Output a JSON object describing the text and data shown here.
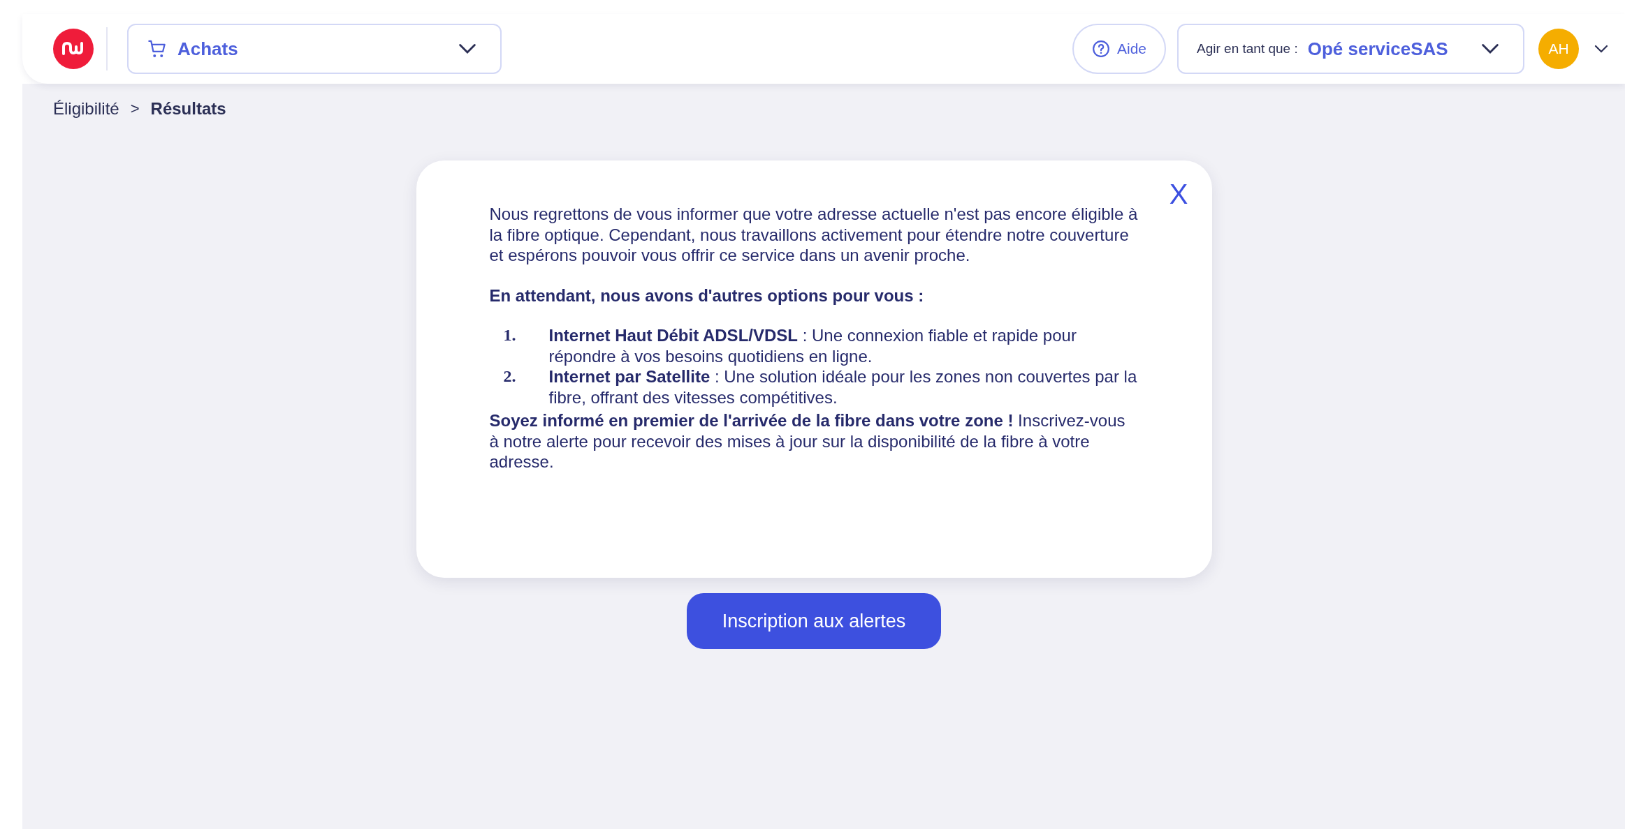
{
  "header": {
    "module_select": {
      "value": "Achats"
    },
    "help_button": {
      "label": "Aide"
    },
    "role_select": {
      "label": "Agir en tant que :",
      "value": "Opé serviceSAS"
    },
    "avatar": {
      "initials": "AH"
    }
  },
  "breadcrumb": {
    "separator": ">",
    "items": [
      {
        "label": "Éligibilité",
        "selected": false
      },
      {
        "label": "Résultats",
        "selected": true
      }
    ]
  },
  "modal": {
    "close": "X",
    "blocks": [
      {
        "kind": "paragraph",
        "text": "Nous regrettons de vous informer que votre adresse actuelle n'est pas encore éligible à la fibre optique. Cependant, nous travaillons activement pour étendre notre couverture et espérons pouvoir vous offrir ce service dans un avenir proche."
      },
      {
        "kind": "heading",
        "text": "En attendant, nous avons d'autres options pour vous :"
      },
      {
        "kind": "list",
        "items": [
          {
            "number": "1.",
            "text": "**Internet Haut Débit ADSL/VDSL** : Une connexion fiable et rapide pour répondre à vos besoins quotidiens en ligne."
          },
          {
            "number": "2.",
            "text": "**Internet par Satellite** : Une solution idéale pour les zones non couvertes par la fibre, offrant des vitesses compétitives."
          }
        ]
      },
      {
        "kind": "paragraph",
        "text": "**Soyez informé en premier de l'arrivée de la fibre dans votre zone !** Inscrivez-vous à notre alerte pour recevoir des mises à jour sur la disponibilité de la fibre à votre adresse."
      }
    ]
  },
  "alert_button": {
    "label": "Inscription aux alertes"
  }
}
